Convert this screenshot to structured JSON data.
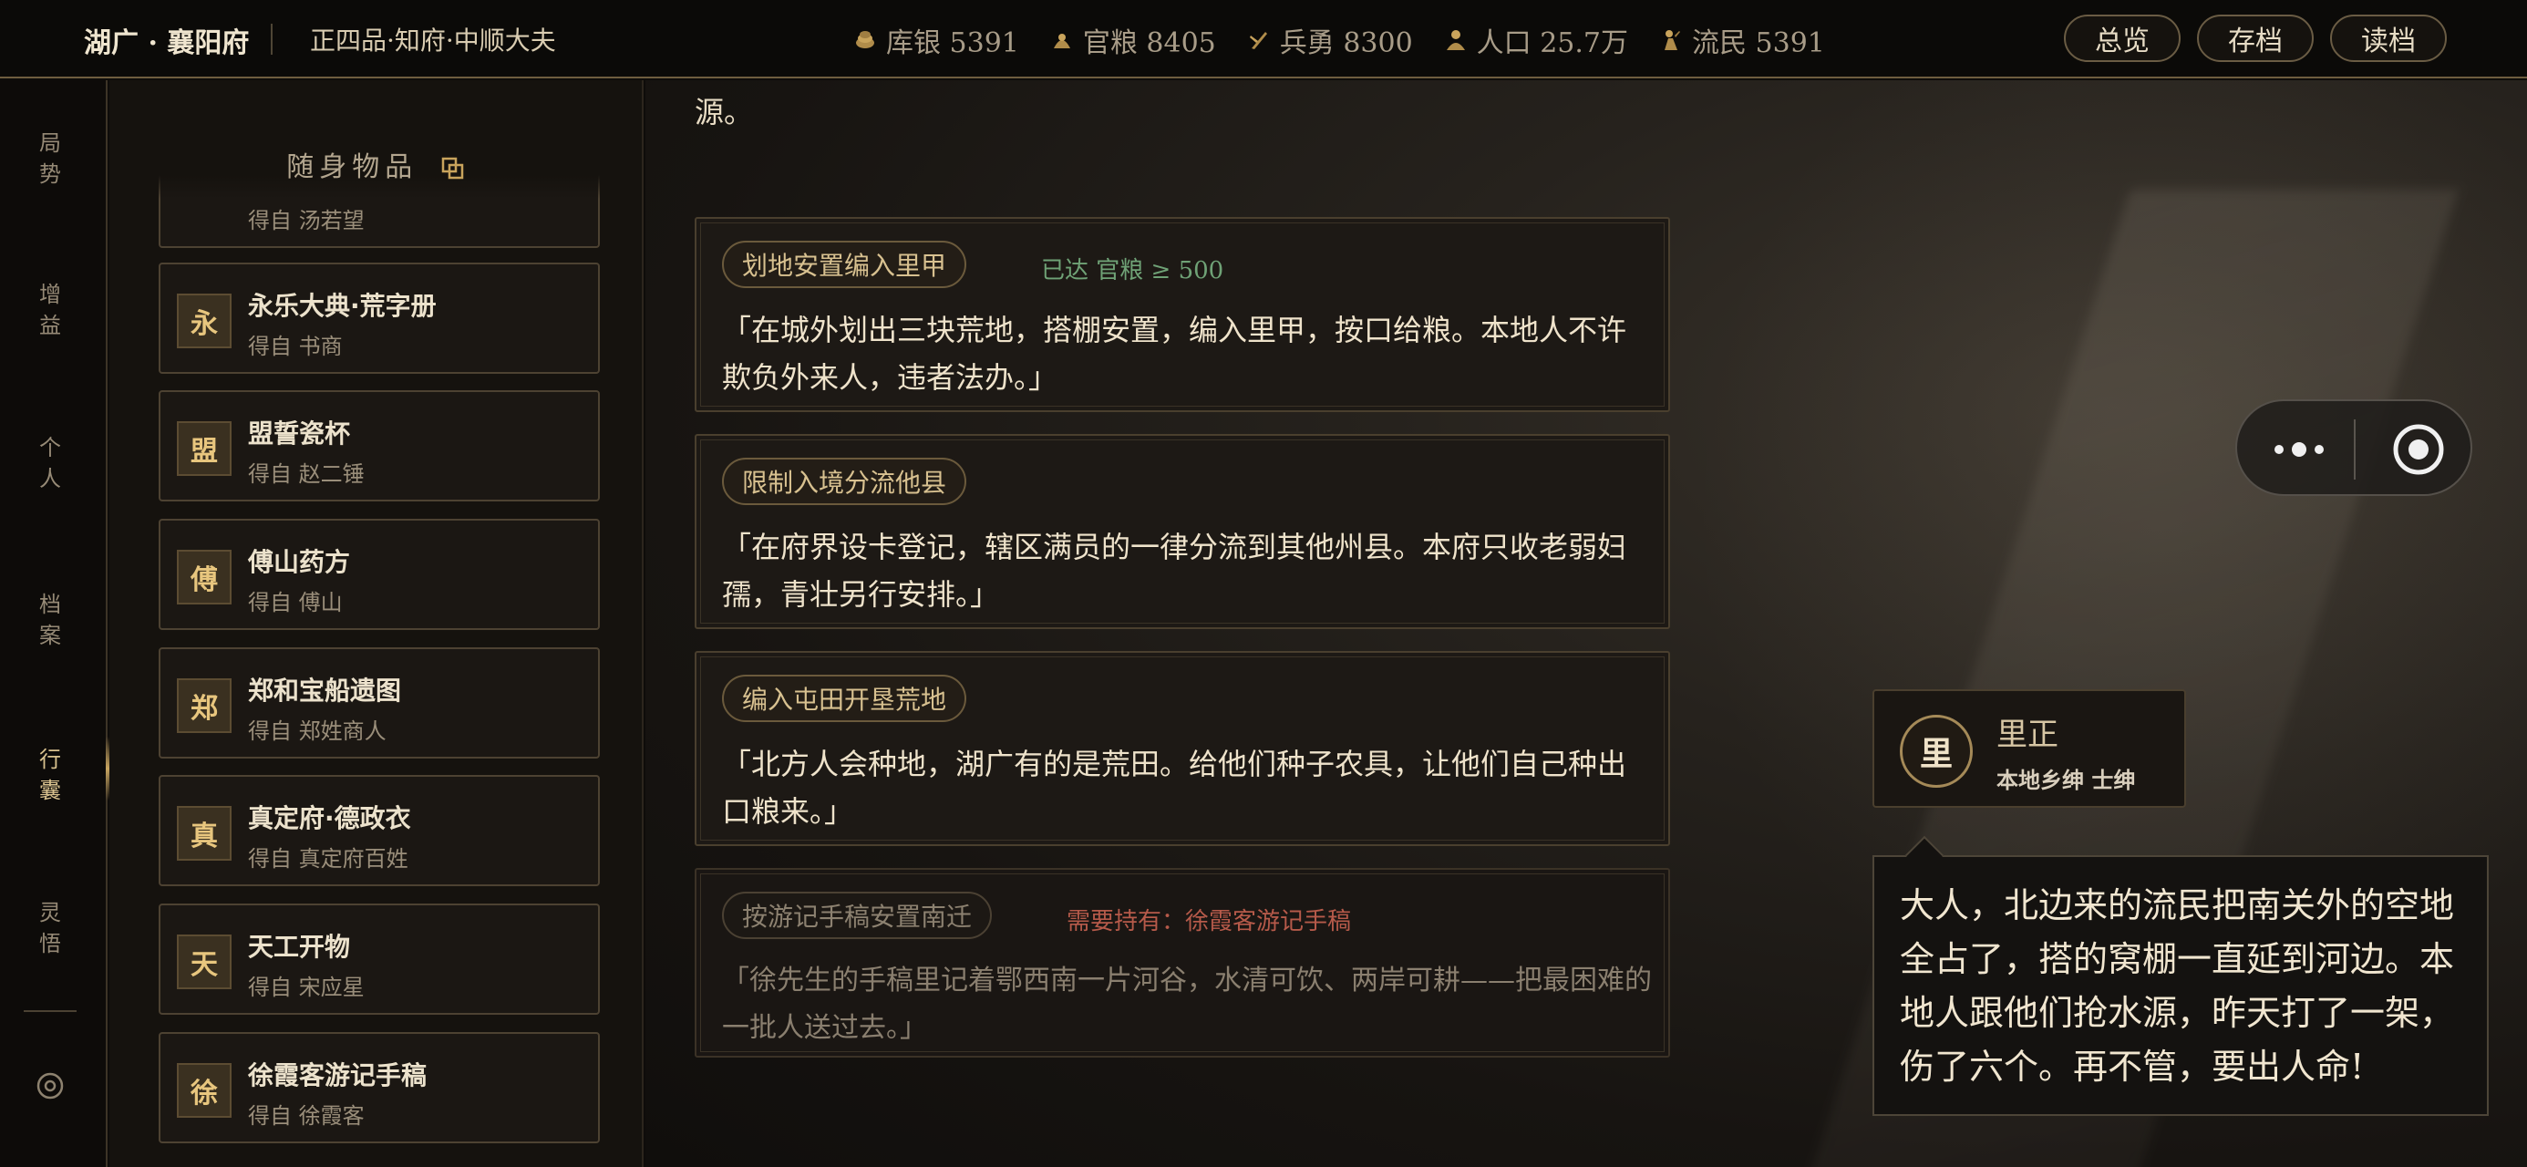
{
  "topbar": {
    "title": "湖广 · 襄阳府",
    "rank": "正四品·知府·中顺大夫",
    "stats": [
      {
        "icon": "coins-icon",
        "label": "库银 5391"
      },
      {
        "icon": "grain-icon",
        "label": "官粮 8405"
      },
      {
        "icon": "soldier-icon",
        "label": "兵勇 8300"
      },
      {
        "icon": "people-icon",
        "label": "人口 25.7万"
      },
      {
        "icon": "refugee-icon",
        "label": "流民 5391"
      }
    ],
    "buttons": {
      "overview": "总览",
      "save": "存档",
      "load": "读档"
    }
  },
  "nav": {
    "items": [
      {
        "label": "局势"
      },
      {
        "label": "增益"
      },
      {
        "label": "个人"
      },
      {
        "label": "档案"
      },
      {
        "label": "行囊",
        "active": true
      },
      {
        "label": "灵悟"
      }
    ]
  },
  "inventory": {
    "title": "随身物品",
    "partial_item": {
      "source": "得自 汤若望"
    },
    "items": [
      {
        "badge": "永",
        "name": "永乐大典·荒字册",
        "source": "得自 书商"
      },
      {
        "badge": "盟",
        "name": "盟誓瓷杯",
        "source": "得自 赵二锤"
      },
      {
        "badge": "傅",
        "name": "傅山药方",
        "source": "得自 傅山"
      },
      {
        "badge": "郑",
        "name": "郑和宝船遗图",
        "source": "得自 郑姓商人"
      },
      {
        "badge": "真",
        "name": "真定府·德政衣",
        "source": "得自 真定府百姓"
      },
      {
        "badge": "天",
        "name": "天工开物",
        "source": "得自 宋应星"
      },
      {
        "badge": "徐",
        "name": "徐霞客游记手稿",
        "source": "得自 徐霞客"
      }
    ]
  },
  "story": {
    "lead": "源。"
  },
  "options": [
    {
      "tag": "划地安置编入里甲",
      "condition": "已达 官粮 ≥ 500",
      "condition_type": "ok",
      "text": "「在城外划出三块荒地，搭棚安置，编入里甲，按口给粮。本地人不许欺负外来人，违者法办。」"
    },
    {
      "tag": "限制入境分流他县",
      "condition": "",
      "condition_type": "none",
      "text": "「在府界设卡登记，辖区满员的一律分流到其他州县。本府只收老弱妇孺，青壮另行安排。」"
    },
    {
      "tag": "编入屯田开垦荒地",
      "condition": "",
      "condition_type": "none",
      "text": "「北方人会种地，湖广有的是荒田。给他们种子农具，让他们自己种出口粮来。」"
    },
    {
      "tag": "按游记手稿安置南迁",
      "condition": "需要持有：徐霞客游记手稿",
      "condition_type": "required",
      "text": "「徐先生的手稿里记着鄂西南一片河谷，水清可饮、两岸可耕——把最困难的一批人送过去。」"
    }
  ],
  "npc": {
    "avatar": "里",
    "name": "里正",
    "role": "本地乡绅 士绅",
    "speech": "大人，北边来的流民把南关外的空地全占了，搭的窝棚一直延到河边。本地人跟他们抢水源，昨天打了一架，伤了六个。再不管，要出人命!"
  },
  "colors": {
    "accent": "#c8a560",
    "ok": "#6fa276",
    "required": "#b65a4a",
    "panel": "#15120e"
  }
}
